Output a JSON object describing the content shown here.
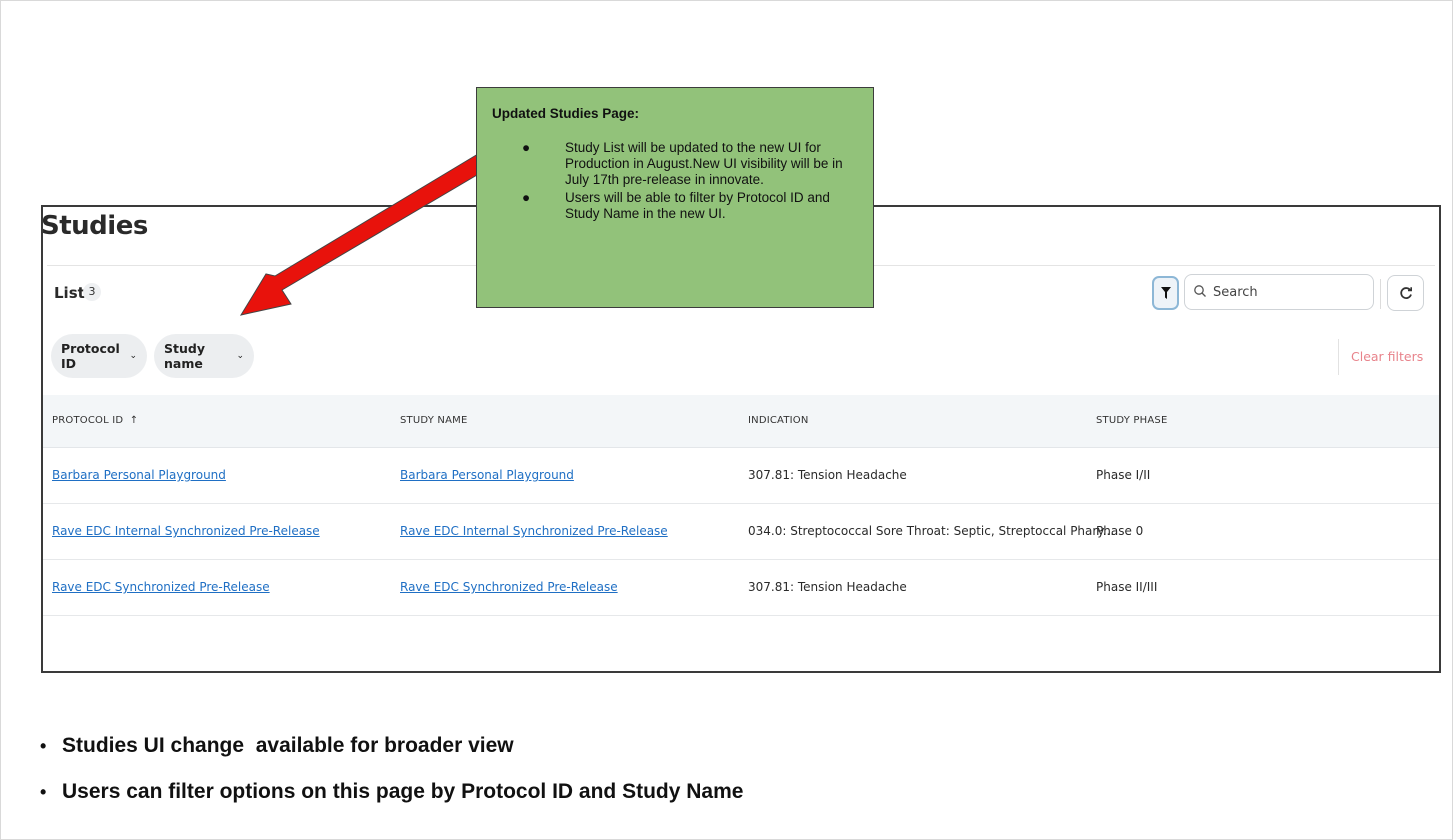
{
  "page": {
    "title": "Studies",
    "list_label": "List",
    "list_count": "3"
  },
  "toolbar": {
    "filter_icon": "filter-icon",
    "search_placeholder": "Search",
    "refresh_icon": "refresh-icon"
  },
  "filters": {
    "chips": [
      {
        "label": "Protocol ID"
      },
      {
        "label": "Study name"
      }
    ],
    "clear_label": "Clear filters",
    "clear_color": "#e8838b"
  },
  "table": {
    "columns": [
      "PROTOCOL ID",
      "STUDY NAME",
      "INDICATION",
      "STUDY PHASE"
    ],
    "sort_indicator": "↑",
    "rows": [
      {
        "protocol_id": "Barbara Personal Playground",
        "study_name": "Barbara Personal Playground",
        "indication": "307.81: Tension Headache",
        "phase": "Phase I/II"
      },
      {
        "protocol_id": "Rave EDC Internal Synchronized Pre-Release",
        "study_name": "Rave EDC Internal Synchronized Pre-Release",
        "indication": "034.0: Streptococcal Sore Throat: Septic, Streptoccal Phary...",
        "phase": "Phase 0"
      },
      {
        "protocol_id": "Rave EDC Synchronized Pre-Release",
        "study_name": "Rave EDC Synchronized Pre-Release",
        "indication": "307.81: Tension Headache",
        "phase": "Phase II/III"
      }
    ],
    "link_color": "#1f6fc4"
  },
  "callout": {
    "title": "Updated Studies Page:",
    "items": [
      "Study List will be updated to the new UI for Production in August.New UI visibility will be in July 17th pre-release in innovate.",
      "Users will be able to filter by Protocol ID and Study Name in the new UI."
    ],
    "background": "#92c27a",
    "arrow_color": "#e8120c"
  },
  "bullets": [
    "Studies UI change  available for broader view",
    "Users can filter options on this page by Protocol ID and Study Name"
  ]
}
